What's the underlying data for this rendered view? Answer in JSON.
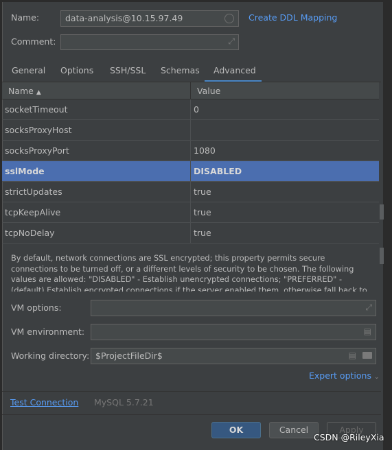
{
  "header": {
    "name_label": "Name:",
    "name_value": "data-analysis@10.15.97.49",
    "comment_label": "Comment:",
    "comment_value": "",
    "create_ddl_link": "Create DDL Mapping"
  },
  "tabs": [
    {
      "label": "General"
    },
    {
      "label": "Options"
    },
    {
      "label": "SSH/SSL"
    },
    {
      "label": "Schemas"
    },
    {
      "label": "Advanced",
      "active": true
    }
  ],
  "table": {
    "columns": [
      "Name",
      "Value"
    ],
    "sort_indicator": "▲",
    "rows": [
      {
        "name": "socketTimeout",
        "value": "0"
      },
      {
        "name": "socksProxyHost",
        "value": ""
      },
      {
        "name": "socksProxyPort",
        "value": "1080"
      },
      {
        "name": "sslMode",
        "value": "DISABLED",
        "selected": true
      },
      {
        "name": "strictUpdates",
        "value": "true"
      },
      {
        "name": "tcpKeepAlive",
        "value": "true"
      },
      {
        "name": "tcpNoDelay",
        "value": "true"
      }
    ]
  },
  "description": "By default, network connections are SSL encrypted; this property permits secure connections to be turned off, or a different levels of security to be chosen. The following values are allowed: \"DISABLED\" - Establish unencrypted connections; \"PREFERRED\" - (default) Establish encrypted connections if the server enabled them, otherwise fall back to unencrypted connections;",
  "vm": {
    "options_label": "VM options:",
    "options_value": "",
    "environment_label": "VM environment:",
    "environment_value": "",
    "workdir_label": "Working directory:",
    "workdir_value": "$ProjectFileDir$",
    "expert_options": "Expert options"
  },
  "footer": {
    "test_connection": "Test Connection",
    "driver_version": "MySQL 5.7.21",
    "ok": "OK",
    "cancel": "Cancel",
    "apply": "Apply"
  },
  "watermark": "CSDN @RileyXia",
  "colors": {
    "accent": "#4b6eaf",
    "link": "#589df6",
    "background": "#3c3f41"
  }
}
